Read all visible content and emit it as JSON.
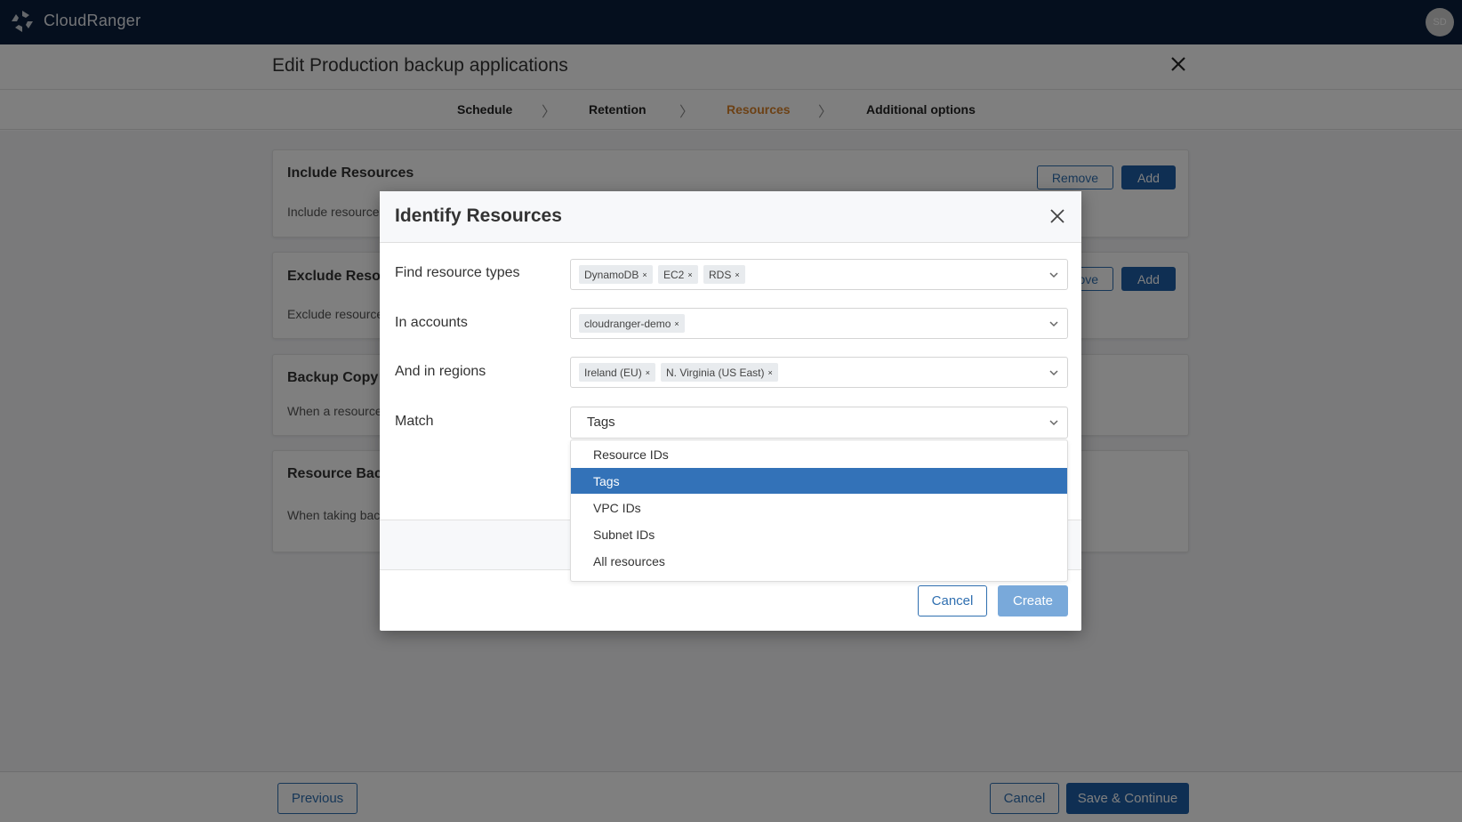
{
  "app": {
    "brand": "CloudRanger",
    "avatar_initials": "SD"
  },
  "page": {
    "title": "Edit Production backup applications",
    "steps": [
      {
        "label": "Schedule",
        "active": false
      },
      {
        "label": "Retention",
        "active": false
      },
      {
        "label": "Resources",
        "active": true
      },
      {
        "label": "Additional options",
        "active": false
      }
    ],
    "step_separator": "〉",
    "cards": [
      {
        "title": "Include Resources",
        "desc": "Include resource",
        "remove_label": "Remove",
        "add_label": "Add"
      },
      {
        "title": "Exclude Resou",
        "desc": "Exclude resource",
        "remove_label": "Remove",
        "add_label": "Add"
      },
      {
        "title": "Backup Copy E",
        "desc": "When a resource"
      },
      {
        "title": "Resource Back",
        "desc": "When taking bac"
      }
    ],
    "footer": {
      "previous_label": "Previous",
      "cancel_label": "Cancel",
      "save_label": "Save & Continue"
    }
  },
  "modal": {
    "title": "Identify Resources",
    "fields": {
      "resource_types": {
        "label": "Find resource types",
        "chips": [
          "DynamoDB",
          "EC2",
          "RDS"
        ]
      },
      "accounts": {
        "label": "In accounts",
        "chips": [
          "cloudranger-demo"
        ]
      },
      "regions": {
        "label": "And in regions",
        "chips": [
          "Ireland (EU)",
          "N. Virginia (US East)"
        ]
      },
      "match": {
        "label": "Match",
        "value": "Tags",
        "options": [
          "Resource IDs",
          "Tags",
          "VPC IDs",
          "Subnet IDs",
          "All resources"
        ],
        "selected_index": 1
      }
    },
    "chip_remove_glyph": "×",
    "cancel_label": "Cancel",
    "create_label": "Create"
  },
  "colors": {
    "nav_bg": "#0a1f3c",
    "active_step": "#d9822b",
    "primary": "#1f5fa6",
    "selected_option": "#3372b8",
    "create_disabled": "#79a9da"
  }
}
